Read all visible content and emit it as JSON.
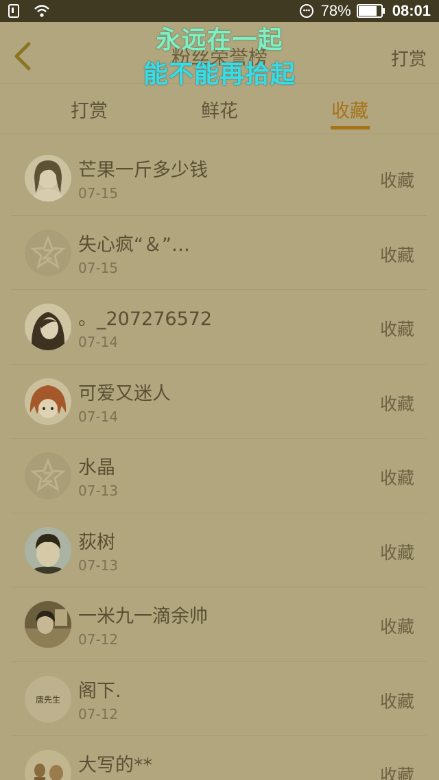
{
  "status_bar": {
    "battery_percent": "78%",
    "time": "08:01",
    "icons": [
      "sim-icon",
      "wifi-icon",
      "emoji-icon",
      "battery-icon"
    ]
  },
  "header": {
    "title": "粉丝荣誉榜",
    "right_action": "打赏",
    "back_icon": "chevron-left-icon"
  },
  "lyrics": {
    "line1": "永远在一起",
    "line2": "能不能再拾起"
  },
  "tabs": [
    {
      "label": "打赏",
      "active": false
    },
    {
      "label": "鲜花",
      "active": false
    },
    {
      "label": "收藏",
      "active": true
    }
  ],
  "colors": {
    "accent": "#a6731a",
    "background": "#b1a67e",
    "status_bar": "#403a22"
  },
  "list": [
    {
      "name": "芒果一斤多少钱",
      "date": "07-15",
      "action": "收藏",
      "avatar": "photo-avatar"
    },
    {
      "name": "失心疯“＆”…",
      "date": "07-15",
      "action": "收藏",
      "avatar": "default-star-avatar"
    },
    {
      "name": "。_207276572",
      "date": "07-14",
      "action": "收藏",
      "avatar": "photo-avatar"
    },
    {
      "name": "可爱又迷人",
      "date": "07-14",
      "action": "收藏",
      "avatar": "anime-avatar"
    },
    {
      "name": "水晶",
      "date": "07-13",
      "action": "收藏",
      "avatar": "default-star-avatar"
    },
    {
      "name": "荻树",
      "date": "07-13",
      "action": "收藏",
      "avatar": "photo-avatar"
    },
    {
      "name": "一米九一滴余帅",
      "date": "07-12",
      "action": "收藏",
      "avatar": "photo-avatar"
    },
    {
      "name": "阁下.",
      "date": "07-12",
      "action": "收藏",
      "avatar": "text-avatar",
      "avatar_text": "唐先生"
    },
    {
      "name": "大写的**",
      "date": "",
      "action": "收藏",
      "avatar": "photo-avatar"
    }
  ]
}
